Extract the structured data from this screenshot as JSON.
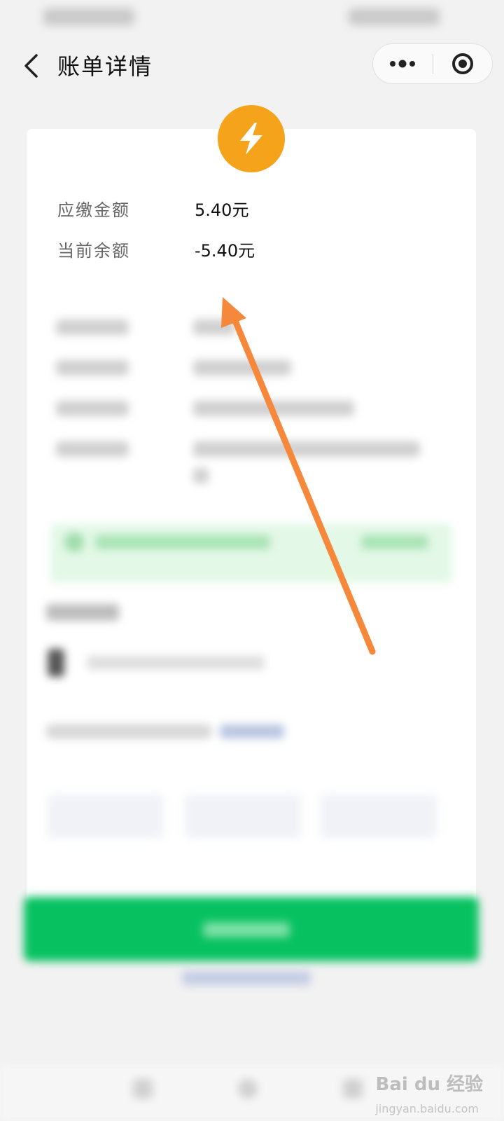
{
  "nav": {
    "title": "账单详情"
  },
  "bill": {
    "rows": [
      {
        "label": "应缴金额",
        "value": "5.40元"
      },
      {
        "label": "当前余额",
        "value": "-5.40元"
      }
    ]
  },
  "colors": {
    "accent_orange": "#f5a31a",
    "arrow_orange": "#f5883a",
    "wechat_green": "#07c160"
  },
  "icons": {
    "back": "chevron-left-icon",
    "more": "more-dots-icon",
    "close": "target-circle-icon",
    "bill": "lightning-bolt-icon"
  },
  "watermark": {
    "brand": "Bai du 经验",
    "url": "jingyan.baidu.com"
  }
}
